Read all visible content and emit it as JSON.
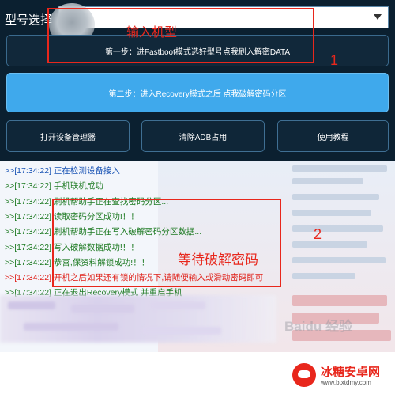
{
  "header": {
    "model_label": "型号选择",
    "model_value": ""
  },
  "buttons": {
    "step1": "第一步：进Fastboot模式选好型号点我刷入解密DATA",
    "step2": "第二步：进入Recovery模式之后 点我破解密码分区",
    "open_device_manager": "打开设备管理器",
    "clear_adb": "清除ADB占用",
    "tutorial": "使用教程"
  },
  "annotations": {
    "box1_text": "输入机型",
    "box1_number": "1",
    "box2_text": "等待破解密码",
    "box2_number": "2"
  },
  "log": [
    {
      "text": ">>[17:34:22] 正在检测设备接入",
      "color": "blue"
    },
    {
      "text": ">>[17:34:22] 手机联机成功",
      "color": "green"
    },
    {
      "text": ">>[17:34:22] 刷机帮助手正在查找密码分区...",
      "color": "green"
    },
    {
      "text": ">>[17:34:22] 读取密码分区成功!！！",
      "color": "green"
    },
    {
      "text": ">>[17:34:22] 刷机帮助手正在写入破解密码分区数据...",
      "color": "green"
    },
    {
      "text": ">>[17:34:22] 写入破解数据成功!！！",
      "color": "green"
    },
    {
      "text": ">>[17:34:22] 恭喜,保资料解锁成功!！！",
      "color": "green"
    },
    {
      "text": ">>[17:34:22] 开机之后如果还有锁的情况下,请随便输入或滑动密码即可",
      "color": "red"
    },
    {
      "text": ">>[17:34:22] 正在退出Recovery模式 并重启手机",
      "color": "green"
    }
  ],
  "watermark": {
    "title": "冰糖安卓网",
    "url": "www.btxtdmy.com",
    "baidu": "Baidu 经验"
  },
  "colors": {
    "app_background": "#0b2030",
    "step2_background": "#3fa9ec",
    "annotation_red": "#e8271c",
    "log_green": "#1d7a22",
    "log_blue": "#1b55b5",
    "log_red": "#e0211a"
  }
}
